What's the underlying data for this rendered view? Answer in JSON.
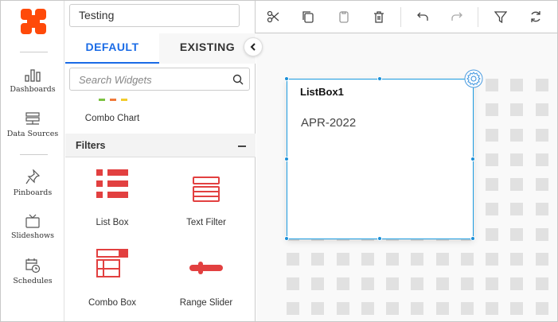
{
  "sidebar": {
    "items": [
      {
        "label": "Dashboards",
        "icon": "bar-chart-icon"
      },
      {
        "label": "Data Sources",
        "icon": "server-icon"
      },
      {
        "label": "Pinboards",
        "icon": "pin-icon"
      },
      {
        "label": "Slideshows",
        "icon": "tv-icon"
      },
      {
        "label": "Schedules",
        "icon": "calendar-clock-icon"
      }
    ]
  },
  "header": {
    "title": "Testing"
  },
  "toolbar": {
    "icons": [
      "cut-icon",
      "copy-icon",
      "paste-icon",
      "delete-icon",
      "undo-icon",
      "redo-icon",
      "filter-icon",
      "refresh-icon"
    ]
  },
  "panel": {
    "tabs": [
      "DEFAULT",
      "EXISTING"
    ],
    "search_placeholder": "Search Widgets",
    "combo_chart": "Combo Chart",
    "section": "Filters",
    "widgets": [
      "List Box",
      "Text Filter",
      "Combo Box",
      "Range Slider"
    ]
  },
  "canvas": {
    "widget_title": "ListBox1",
    "widget_value": "APR-2022"
  },
  "colors": {
    "accent": "#1a6be6",
    "brand": "#ff4a0a",
    "widget_red": "#e24040",
    "selection": "#1a9be0"
  }
}
